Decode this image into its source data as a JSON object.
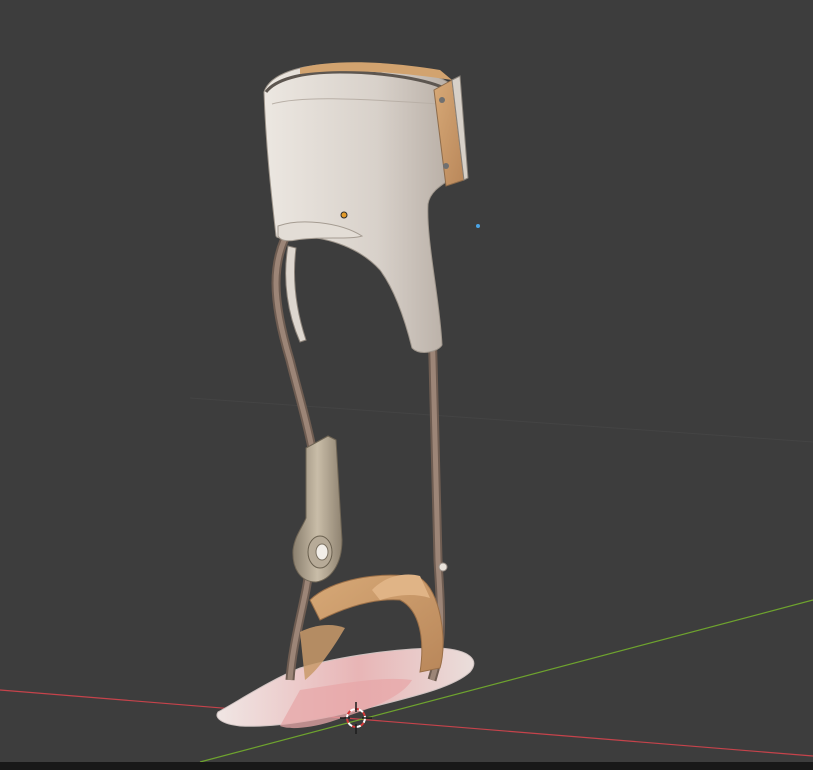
{
  "viewport": {
    "background_color": "#3d3d3d",
    "status_strip_color": "#181818"
  },
  "scene": {
    "object": "ankle-foot-orthosis",
    "x_axis_color": "#c6434b",
    "y_axis_color": "#6ea32e",
    "cuff_color": "#d9d2cb",
    "strut_color": "#8a7366",
    "strap_color": "#c99a6a",
    "footplate_color": "#e8dedd",
    "footplate_selected_color": "#e7a7a8",
    "hinge_color": "#a89a86",
    "origin_dot_color": "#e39b2b",
    "light_color": "#4aa4e6"
  }
}
